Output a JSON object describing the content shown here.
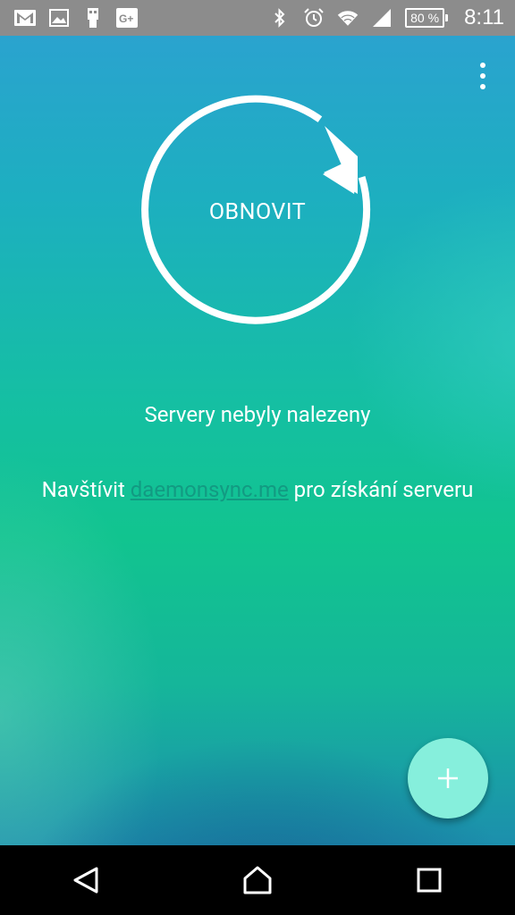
{
  "status_bar": {
    "left_icons": [
      "gmail-icon",
      "gallery-icon",
      "usb-debug-icon",
      "google-plus-icon"
    ],
    "right_icons": [
      "bluetooth-icon",
      "alarm-icon",
      "wifi-icon",
      "signal-icon"
    ],
    "battery": "80 %",
    "time": "8:11"
  },
  "main": {
    "refresh_label": "OBNOVIT",
    "no_servers_text": "Servery nebyly nalezeny",
    "visit_prefix": "Navštívit ",
    "visit_link": "daemonsync.me",
    "visit_suffix": " pro získání serveru"
  },
  "fab": {
    "icon": "plus-icon"
  },
  "nav_bar": {
    "icons": [
      "back-icon",
      "home-icon",
      "recents-icon"
    ]
  },
  "colors": {
    "accent": "#86efdc",
    "link": "#129a82",
    "status_bar_bg": "#8c8c8c"
  }
}
